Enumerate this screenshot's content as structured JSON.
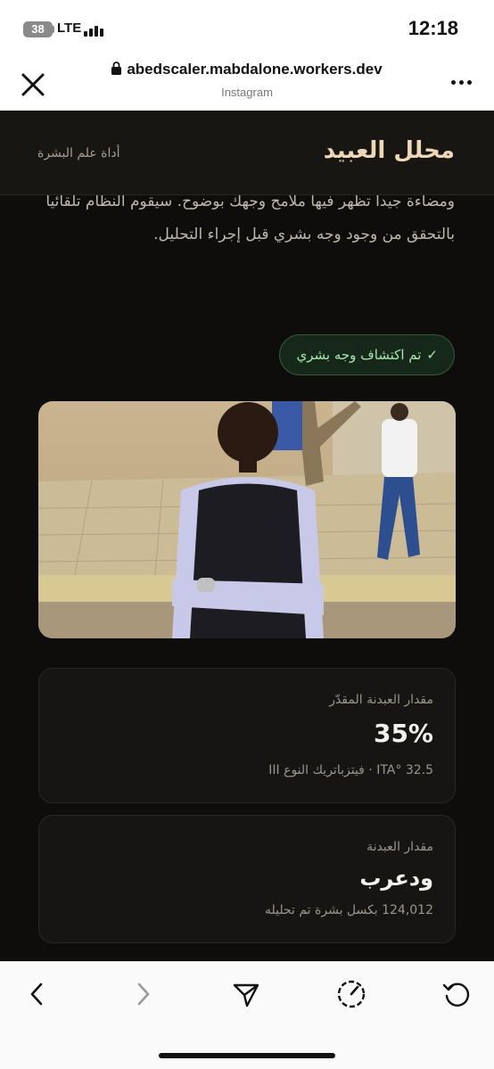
{
  "status_bar": {
    "battery": "38",
    "network": "LTE",
    "time": "12:18"
  },
  "browser": {
    "url": "abedscaler.mabdalone.workers.dev",
    "source": "Instagram"
  },
  "site": {
    "brand": "محلل العبيد",
    "tagline": "أداة علم البشرة",
    "intro": "ومضاءة جيدا تظهر فيها ملامح وجهك بوضوح. سيقوم النظام تلقائياً بالتحقق من وجود وجه بشري قبل إجراء التحليل.",
    "badge_check": "✓",
    "badge_text": "تم اكتشاف وجه بشري"
  },
  "results": [
    {
      "label": "مقدار العبدنة المقدّر",
      "value": "35%",
      "note": "ITA° 32.5 · فيتزباتريك النوع III"
    },
    {
      "label": "مقدار العبدنة",
      "value": "ودعرب",
      "note": "124,012 بكسل بشرة تم تحليله"
    }
  ],
  "colors": {
    "page_bg": "#0e0d0c",
    "brand": "#eed7b8",
    "badge_text": "#a8e8ae",
    "card_bg": "#161513"
  },
  "icons": {
    "close": "close-icon",
    "lock": "lock-icon",
    "more": "more-icon",
    "back": "chevron-left-icon",
    "forward": "chevron-right-icon",
    "share": "send-icon",
    "speed": "gauge-icon",
    "reload": "reload-icon"
  }
}
